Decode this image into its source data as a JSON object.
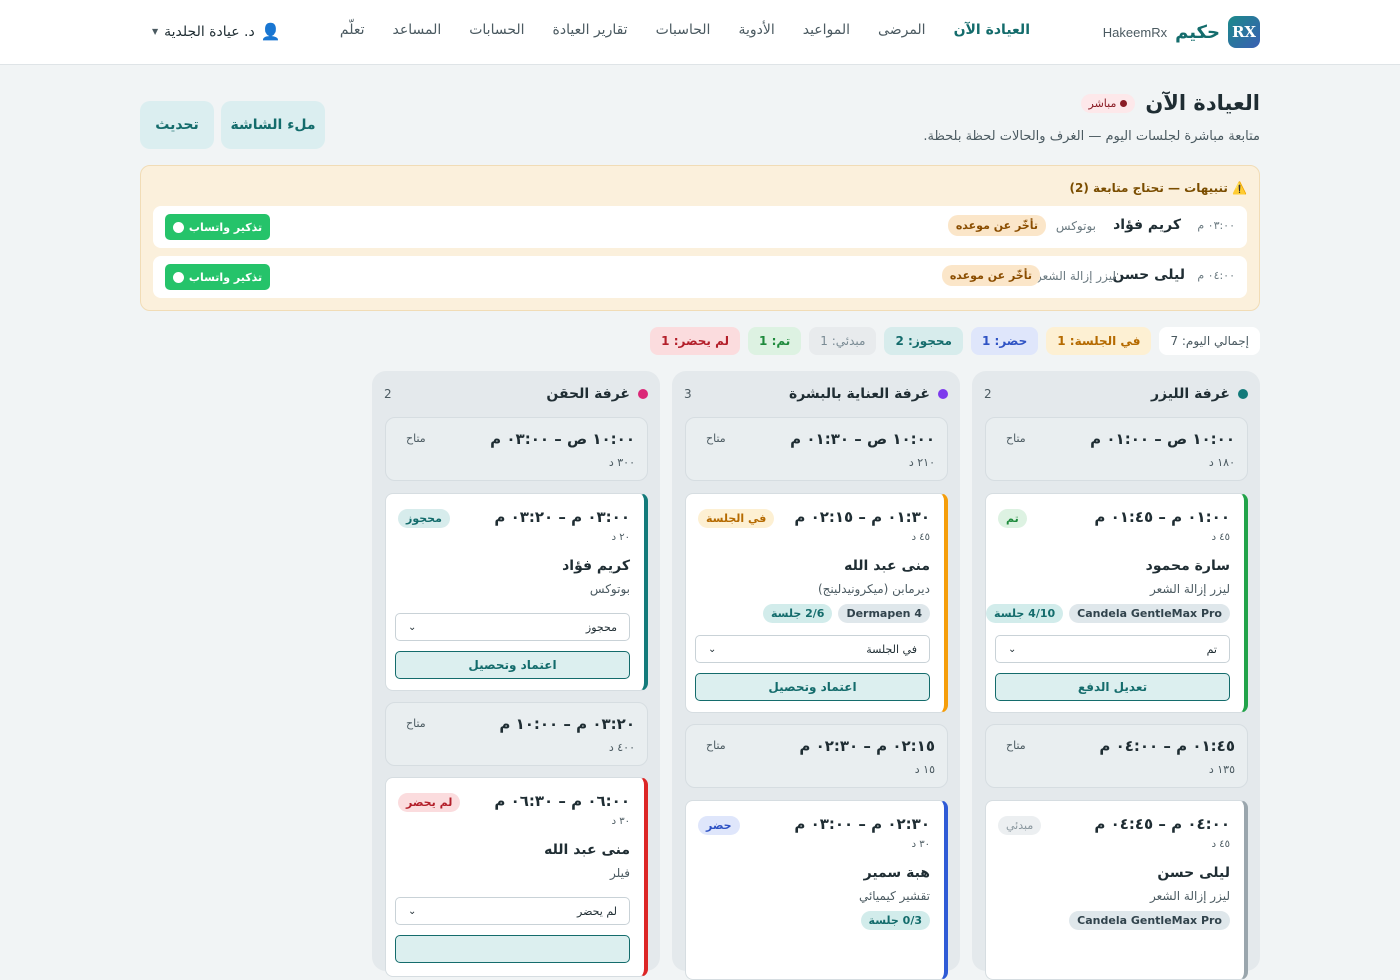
{
  "nav": {
    "brand_ar": "حكيم",
    "brand_en": "HakeemRx",
    "logo_text": "RX",
    "links": [
      "العيادة الآن",
      "المرضى",
      "المواعيد",
      "الأدوية",
      "الحاسبات",
      "تقارير العيادة",
      "الحسابات",
      "المساعد",
      "تعلّم"
    ],
    "user": "د. عيادة الجلدية"
  },
  "header": {
    "title": "العيادة الآن",
    "live": "مباشر",
    "subtitle": "متابعة مباشرة لجلسات اليوم — الغرف والحالات لحظة بلحظة.",
    "fullscreen_btn": "ملء الشاشة",
    "refresh_btn": "تحديث"
  },
  "alerts": {
    "title": "⚠️ تنبيهات — تحتاج متابعة (2)",
    "items": [
      {
        "time": "٠٣:٠٠ م",
        "name": "كريم فؤاد",
        "service": "بوتوكس",
        "status": "تأخّر عن موعده",
        "action": "تذكير واتساب"
      },
      {
        "time": "٠٤:٠٠ م",
        "name": "ليلى حسن",
        "service": "ليزر إزالة الشعر",
        "status": "تأخّر عن موعده",
        "action": "تذكير واتساب"
      }
    ]
  },
  "stats": {
    "total": "إجمالي اليوم: 7",
    "in_session": "في الجلسة: 1",
    "arrived": "حضر: 1",
    "booked": "محجوز: 2",
    "initial": "مبدئي: 1",
    "done": "تم: 1",
    "no_show": "لم يحضر: 1"
  },
  "rooms": [
    {
      "name": "غرفة الليزر",
      "count": "2",
      "color": "#137a7a",
      "slots": [
        {
          "range": "١٠:٠٠ ص – ٠١:٠٠ م",
          "dur": "١٨٠ د",
          "avail": "متاح"
        },
        {
          "range": "٠١:٤٥ م – ٠٤:٠٠ م",
          "dur": "١٣٥ د",
          "avail": "متاح"
        }
      ],
      "cards": [
        {
          "range": "٠١:٠٠ م – ٠١:٤٥ م",
          "dur": "٤٥ د",
          "badge": "تم",
          "name": "سارة محمود",
          "service": "ليزر إزالة الشعر",
          "tag1": "Candela GentleMax Pro",
          "tag2": "4/10 جلسة",
          "select": "تم",
          "action": "تعديل الدفع"
        },
        {
          "range": "٠٤:٠٠ م – ٠٤:٤٥ م",
          "dur": "٤٥ د",
          "badge": "مبدئي",
          "name": "ليلى حسن",
          "service": "ليزر إزالة الشعر",
          "tag1": "Candela GentleMax Pro"
        }
      ]
    },
    {
      "name": "غرفة العناية بالبشرة",
      "count": "3",
      "color": "#7c3aed",
      "slots": [
        {
          "range": "١٠:٠٠ ص – ٠١:٣٠ م",
          "dur": "٢١٠ د",
          "avail": "متاح"
        },
        {
          "range": "٠٢:١٥ م – ٠٢:٣٠ م",
          "dur": "١٥ د",
          "avail": "متاح"
        }
      ],
      "cards": [
        {
          "range": "٠١:٣٠ م – ٠٢:١٥ م",
          "dur": "٤٥ د",
          "badge": "في الجلسة",
          "name": "منى عبد الله",
          "service": "ديرمابن (ميكرونيدلينج)",
          "tag1": "Dermapen 4",
          "tag2": "2/6 جلسة",
          "select": "في الجلسة",
          "action": "اعتماد وتحصيل"
        },
        {
          "range": "٠٢:٣٠ م – ٠٣:٠٠ م",
          "dur": "٣٠ د",
          "badge": "حضر",
          "name": "هبة سمير",
          "service": "تقشير كيميائي",
          "tag2": "0/3 جلسة"
        }
      ]
    },
    {
      "name": "غرفة الحقن",
      "count": "2",
      "color": "#db2777",
      "slots": [
        {
          "range": "١٠:٠٠ ص – ٠٣:٠٠ م",
          "dur": "٣٠٠ د",
          "avail": "متاح"
        },
        {
          "range": "٠٣:٢٠ م – ١٠:٠٠ م",
          "dur": "٤٠٠ د",
          "avail": "متاح"
        }
      ],
      "cards": [
        {
          "range": "٠٣:٠٠ م – ٠٣:٢٠ م",
          "dur": "٢٠ د",
          "badge": "محجوز",
          "name": "كريم فؤاد",
          "service": "بوتوكس",
          "select": "محجوز",
          "action": "اعتماد وتحصيل"
        },
        {
          "range": "٠٦:٠٠ م – ٠٦:٣٠ م",
          "dur": "٣٠ د",
          "badge": "لم يحضر",
          "name": "منى عبد الله",
          "service": "فيلر",
          "select": "لم يحضر"
        }
      ]
    }
  ]
}
